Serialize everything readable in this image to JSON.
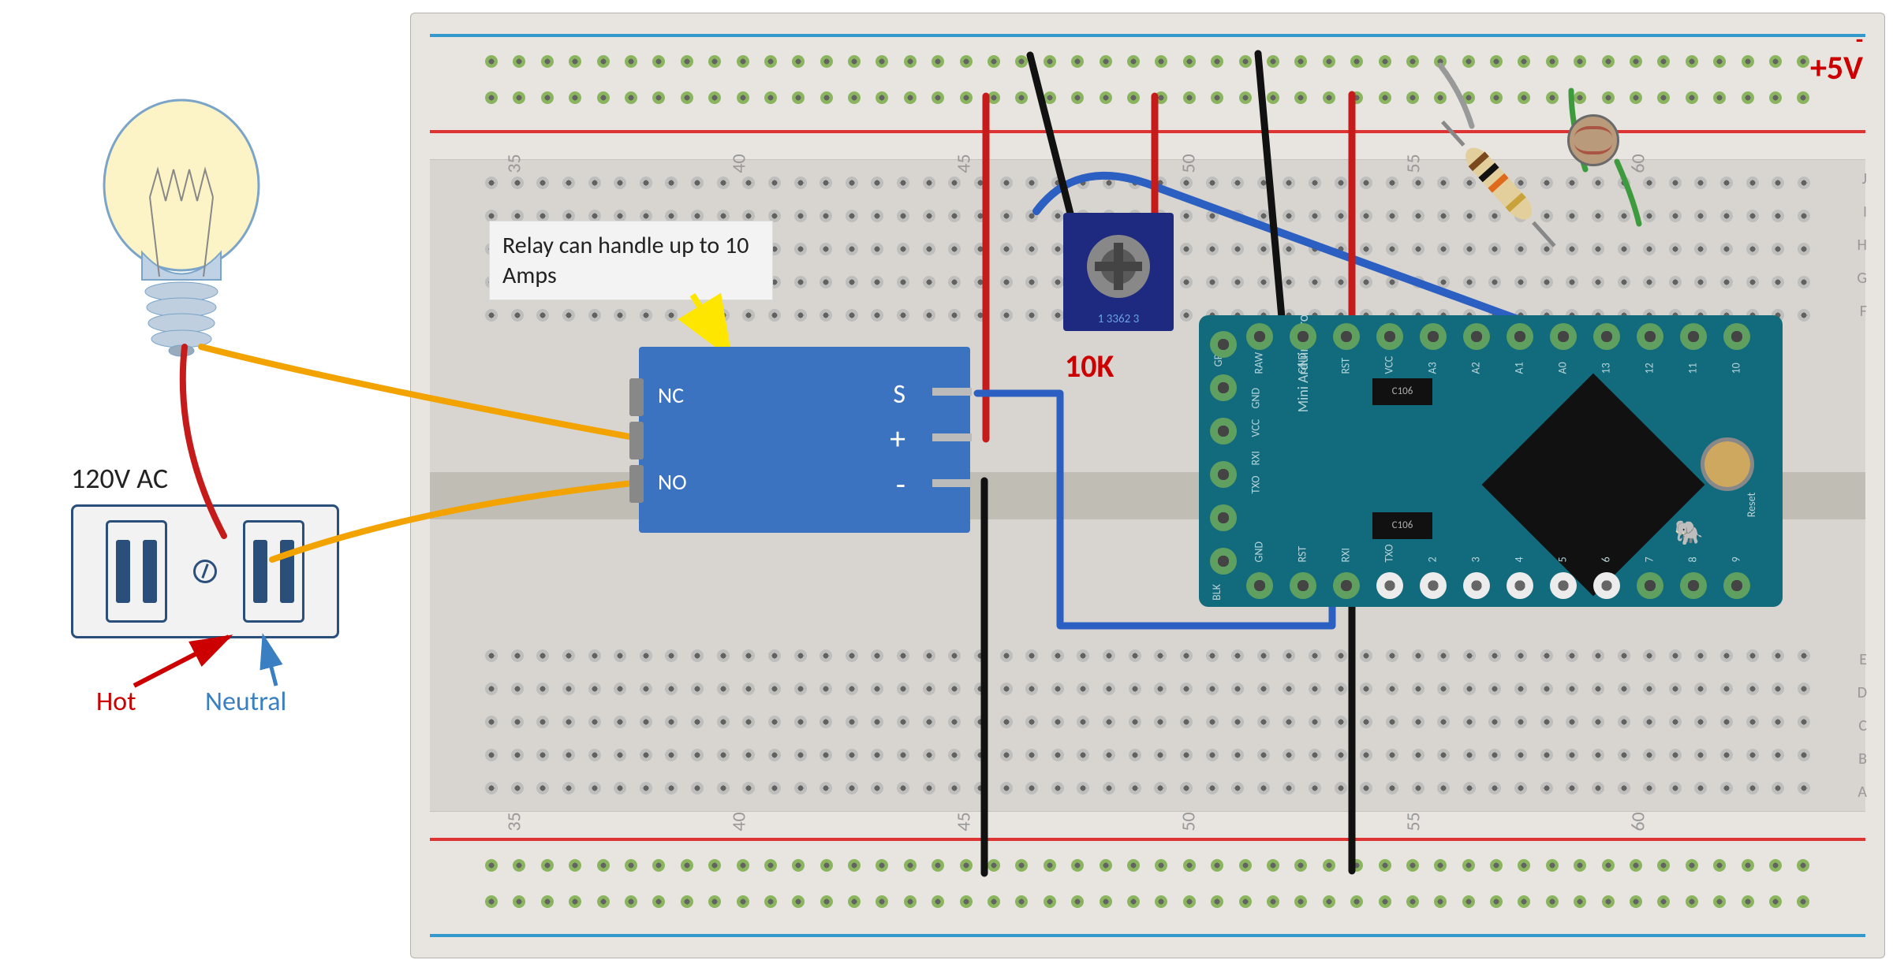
{
  "labels": {
    "ac_source": "120V AC",
    "hot": "Hot",
    "neutral": "Neutral",
    "relay_note": "Relay can handle up to 10 Amps",
    "pot_value": "10K",
    "v_minus": "-",
    "v_plus": "+",
    "v_value": "5V"
  },
  "relay": {
    "nc": "NC",
    "no": "NO",
    "s": "S",
    "plus": "+",
    "minus": "-"
  },
  "trimpot": {
    "marking": "1 3362 3"
  },
  "arduino": {
    "board_name": "Mini Arduino Pro",
    "smd1": "C106",
    "smd2": "C106",
    "top_row_ends": {
      "left": "GRN",
      "right_reset": "Reset"
    },
    "top_pins": [
      "RAW",
      "GND",
      "RST",
      "VCC",
      "A3",
      "A2",
      "A1",
      "A0",
      "13",
      "12",
      "11",
      "10"
    ],
    "middle_left": [
      "GND",
      "VCC",
      "RXI",
      "TXO"
    ],
    "bottom_left": [
      "GND",
      "RST",
      "RXI",
      "TXO"
    ],
    "bottom_row_ends": {
      "left": "BLK"
    },
    "bottom_pins": [
      "2",
      "3",
      "4",
      "5",
      "6",
      "7",
      "8",
      "9"
    ]
  },
  "breadboard": {
    "col_numbers": [
      "35",
      "40",
      "45",
      "50",
      "55",
      "60"
    ],
    "row_letters_top_half": [
      "J",
      "I",
      "H",
      "G",
      "F"
    ],
    "row_letters_bottom_half": [
      "E",
      "D",
      "C",
      "B",
      "A"
    ]
  },
  "components": {
    "bulb": "incandescent light bulb",
    "outlet": "wall AC outlet",
    "relay_module": "5V relay module",
    "trimpot": "10K trim potentiometer",
    "arduino": "Arduino Pro Mini",
    "resistor": "axial resistor (brown-black-orange-gold)",
    "ldr": "photoresistor / LDR"
  },
  "wires": {
    "bulb_to_hot": {
      "color": "red",
      "from": "bulb base",
      "to": "outlet hot"
    },
    "bulb_to_relay_common": {
      "color": "orange",
      "from": "bulb base",
      "to": "relay common"
    },
    "outlet_neutral_to_relay_no": {
      "color": "orange",
      "from": "outlet neutral",
      "to": "relay NO"
    },
    "relay_s_to_arduino_d3": {
      "color": "blue",
      "from": "relay S",
      "to": "arduino D3"
    },
    "relay_plus_to_rail_pos": {
      "color": "red",
      "from": "relay +",
      "to": "top + rail"
    },
    "relay_minus_to_rail_neg_bottom": {
      "color": "black",
      "from": "relay -",
      "to": "bottom - rail"
    },
    "pot_wiper_to_a0_path": {
      "color": "blue",
      "from": "pot wiper",
      "to": "ldr divider node"
    },
    "pot_to_rails_red": {
      "color": "red",
      "from": "pot pin",
      "to": "top + rail"
    },
    "pot_to_rails_black": {
      "color": "black",
      "from": "pot pin",
      "to": "top - rail"
    },
    "arduino_vcc_to_pos": {
      "color": "red",
      "from": "arduino VCC",
      "to": "top + rail"
    },
    "arduino_gnd_to_neg": {
      "color": "black",
      "from": "arduino GND",
      "to": "top - rail"
    },
    "arduino_gnd_to_neg_bottom": {
      "color": "black",
      "from": "arduino GND",
      "to": "bottom - rail"
    },
    "ldr_leads": {
      "color": "green",
      "from": "ldr",
      "to": "rails/node"
    }
  }
}
